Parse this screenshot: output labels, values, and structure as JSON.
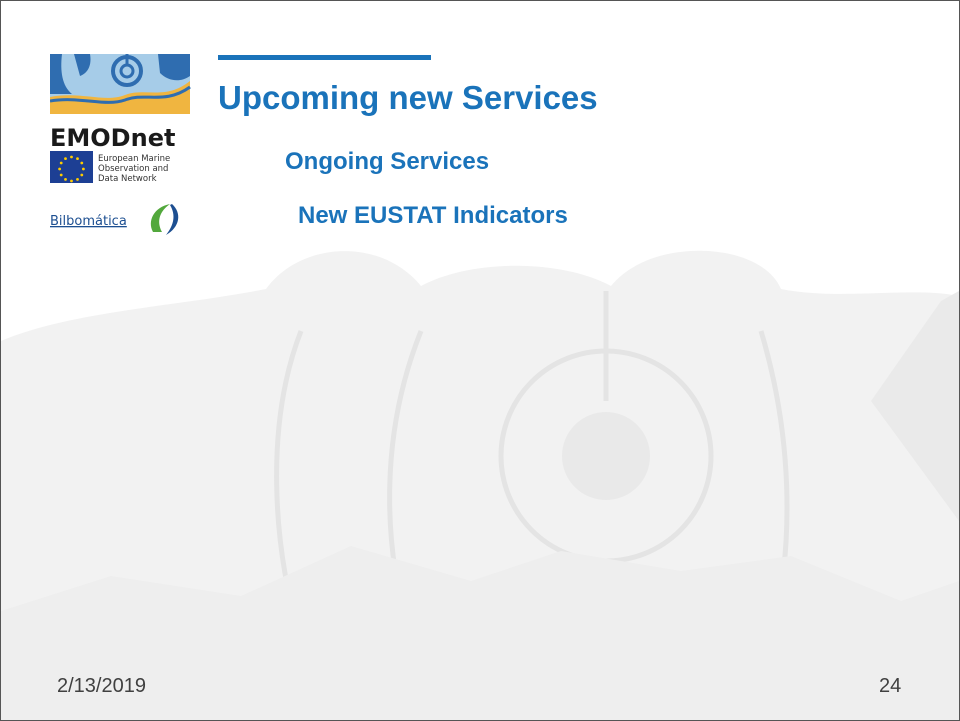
{
  "colors": {
    "accent": "#1a73ba",
    "logo_sand": "#f0b540",
    "logo_blue": "#2f6db0",
    "logo_light_blue": "#a6cce8",
    "eu_blue": "#1d3f94",
    "eu_star": "#ffcc00",
    "bilbo_green": "#52a83c",
    "bilbo_blue": "#1d4f91",
    "footer_text": "#404040",
    "watermark": "#e8e8e8"
  },
  "logo": {
    "brand": "EMODnet",
    "network_line1": "European Marine",
    "network_line2": "Observation and",
    "network_line3": "Data Network",
    "partner": "Bilbomática"
  },
  "slide": {
    "title": "Upcoming new Services",
    "bullets": [
      "Ongoing Services",
      "New EUSTAT Indicators"
    ]
  },
  "footer": {
    "date": "2/13/2019",
    "page_number": "24"
  }
}
